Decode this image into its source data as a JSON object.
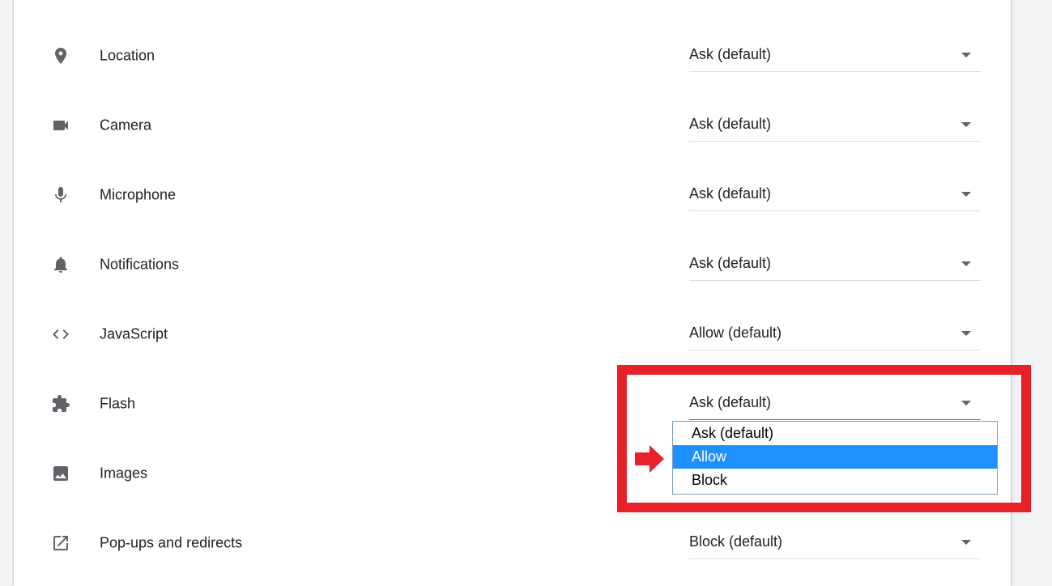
{
  "settings": [
    {
      "label": "Location",
      "value": "Ask (default)",
      "icon": "location-pin-icon"
    },
    {
      "label": "Camera",
      "value": "Ask (default)",
      "icon": "camera-icon"
    },
    {
      "label": "Microphone",
      "value": "Ask (default)",
      "icon": "microphone-icon"
    },
    {
      "label": "Notifications",
      "value": "Ask (default)",
      "icon": "bell-icon"
    },
    {
      "label": "JavaScript",
      "value": "Allow (default)",
      "icon": "code-brackets-icon"
    },
    {
      "label": "Flash",
      "value": "Ask (default)",
      "icon": "puzzle-icon"
    },
    {
      "label": "Images",
      "value": "",
      "icon": "image-icon"
    },
    {
      "label": "Pop-ups and redirects",
      "value": "Block (default)",
      "icon": "open-in-new-icon"
    }
  ],
  "flash_dropdown": {
    "options": [
      "Ask (default)",
      "Allow",
      "Block"
    ],
    "highlighted": "Allow"
  },
  "colors": {
    "highlight_box": "#e8202a",
    "selected_option": "#1e90ff",
    "icon": "#5f6368"
  }
}
